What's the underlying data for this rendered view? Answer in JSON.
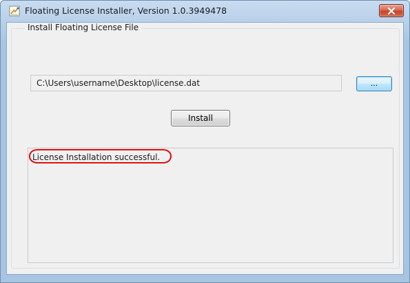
{
  "window": {
    "title": "Floating License Installer, Version 1.0.3949478",
    "app_icon": "license-installer-icon",
    "close_icon": "close-x-icon",
    "accent_colors": {
      "titlebar": "#b7cfe9",
      "close_button": "#d4694d",
      "highlight_ellipse": "#e01010"
    }
  },
  "group": {
    "title": "Install Floating License File"
  },
  "license_file": {
    "path": "C:\\Users\\username\\Desktop\\license.dat",
    "browse_label": "..."
  },
  "install": {
    "label": "Install"
  },
  "log": {
    "message": "License Installation successful."
  }
}
